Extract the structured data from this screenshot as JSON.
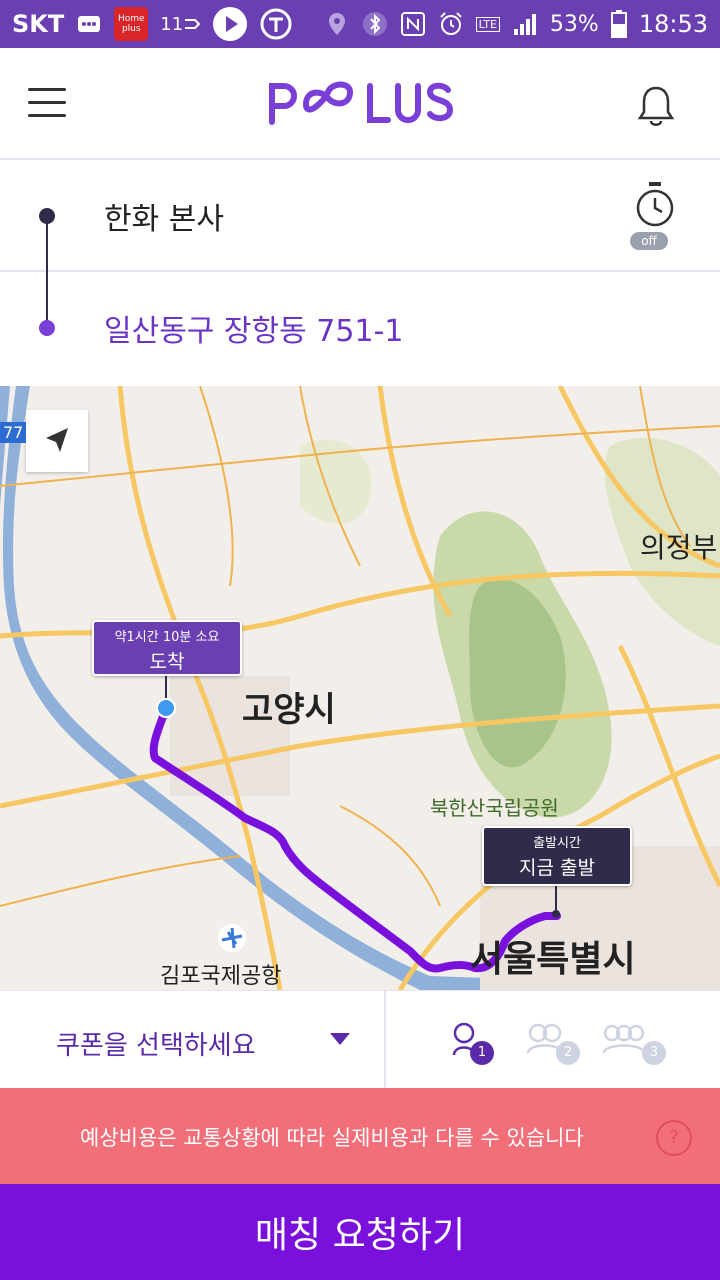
{
  "statusbar": {
    "carrier": "SKT",
    "homeplus_label": "Home plus",
    "data_speed": "11",
    "lte_label": "LTE",
    "battery_percent": "53%",
    "time": "18:53"
  },
  "header": {
    "logo_text": "POOLUS",
    "menu_icon": "hamburger-menu-icon",
    "bell_icon": "bell-icon"
  },
  "route": {
    "origin": "한화 본사",
    "destination": "일산동구 장항동 751-1",
    "timer_state": "off"
  },
  "map": {
    "arrive_bubble": {
      "subtitle": "약1시간 10분 소요",
      "title": "도착"
    },
    "depart_bubble": {
      "subtitle": "출발시간",
      "title": "지금 출발"
    },
    "labels": {
      "goyang": "고양시",
      "uijeongbu": "의정부",
      "bukhansan": "북한산국립공원",
      "seoul": "서울특별시",
      "gimpo": "김포국제공항",
      "road": "77"
    },
    "route_color": "#7a10db"
  },
  "options": {
    "coupon_label": "쿠폰을 선택하세요",
    "seats": [
      "1",
      "2",
      "3"
    ],
    "selected_seat": "1"
  },
  "notice": {
    "text": "예상비용은 교통상황에 따라 실제비용과 다를 수 있습니다",
    "help": "?"
  },
  "cta": {
    "label": "매칭 요청하기"
  },
  "colors": {
    "brand": "#6a3fb2",
    "cta": "#7a10db",
    "notice": "#f26f7a"
  }
}
